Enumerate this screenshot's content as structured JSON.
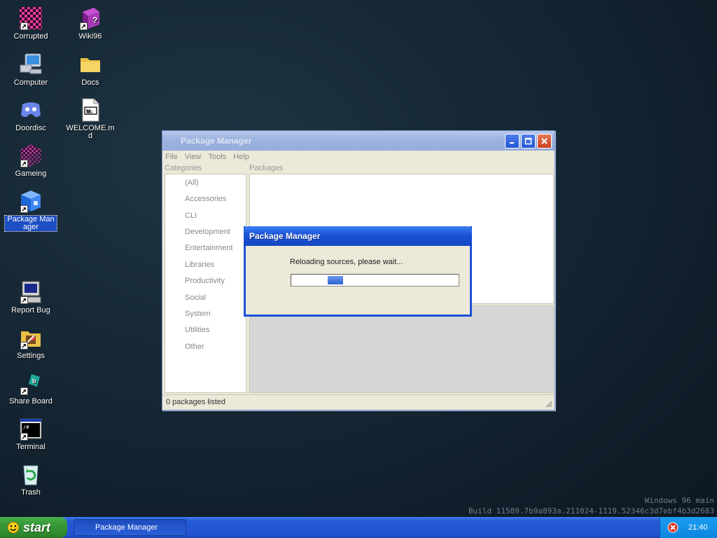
{
  "desktop": {
    "icons": [
      {
        "label": "Corrupted"
      },
      {
        "label": "Wiki96"
      },
      {
        "label": "Computer"
      },
      {
        "label": "Docs"
      },
      {
        "label": "Doordisc"
      },
      {
        "label": "WELCOME.md"
      },
      {
        "label": "Gameing"
      },
      {
        "label": "Package Manager"
      },
      {
        "label": "Report Bug"
      },
      {
        "label": "Settings"
      },
      {
        "label": "Share Board"
      },
      {
        "label": "Terminal"
      },
      {
        "label": "Trash"
      }
    ]
  },
  "window": {
    "title": "Package Manager",
    "menu": [
      "File",
      "View",
      "Tools",
      "Help"
    ],
    "categories_header": "Categories",
    "packages_header": "Packages",
    "categories": [
      "(All)",
      "Accessories",
      "CLI",
      "Development",
      "Entertainment",
      "Libraries",
      "Productivity",
      "Social",
      "System",
      "Utilities",
      "Other"
    ],
    "status": "0 packages listed"
  },
  "dialog": {
    "title": "Package Manager",
    "message": "Reloading sources, please wait..."
  },
  "watermark": {
    "line1": "Windows 96 main",
    "line2": "Build 11589.7b9a893a.211024-1119.52346c3d7ebf4b3d2683"
  },
  "taskbar": {
    "start_label": "start",
    "task_label": "Package Manager",
    "clock": "21:40"
  },
  "colors": {
    "accent": "#1a52d6",
    "start_green": "#3a9b3a",
    "tray_blue": "#0e86de"
  }
}
